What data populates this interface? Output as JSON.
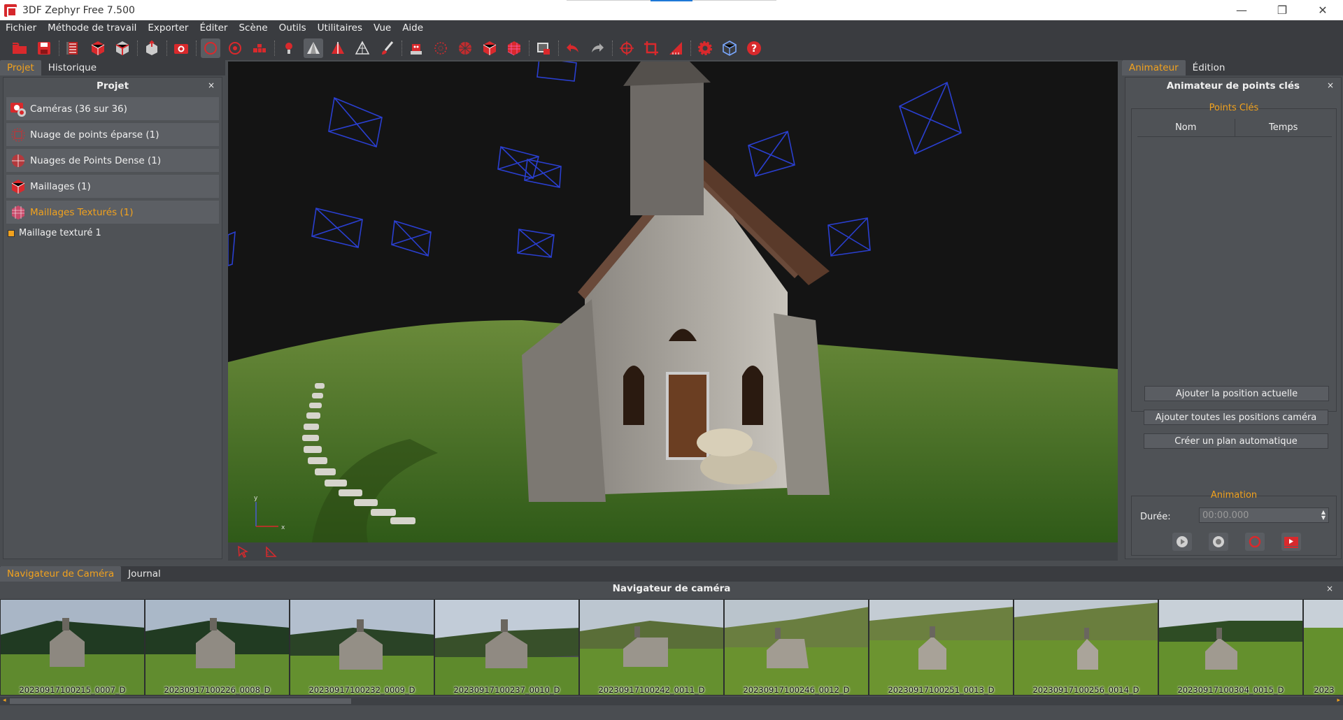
{
  "window": {
    "title": "3DF Zephyr Free 7.500",
    "buttons": [
      "—",
      "❐",
      "✕"
    ]
  },
  "menu": [
    "Fichier",
    "Méthode de travail",
    "Exporter",
    "Éditer",
    "Scène",
    "Outils",
    "Utilitaires",
    "Vue",
    "Aide"
  ],
  "left": {
    "tabs": [
      "Projet",
      "Historique"
    ],
    "title": "Projet",
    "close": "×",
    "items": [
      {
        "label": "Caméras (36 sur 36)"
      },
      {
        "label": "Nuage de points éparse (1)"
      },
      {
        "label": "Nuages de Points Dense (1)"
      },
      {
        "label": "Maillages (1)"
      },
      {
        "label": "Maillages Texturés (1)"
      }
    ],
    "subitem": "Maillage texturé 1"
  },
  "viewport": {
    "axis_x": "x",
    "axis_y": "y"
  },
  "right": {
    "tabs": [
      "Animateur",
      "Édition"
    ],
    "title": "Animateur de points clés",
    "close": "×",
    "keypoints_label": "Points Clés",
    "columns": [
      "Nom",
      "Temps"
    ],
    "buttons": [
      "Ajouter la position actuelle",
      "Ajouter toutes les positions caméra",
      "Créer un plan automatique"
    ],
    "animation_label": "Animation",
    "duration_label": "Durée:",
    "duration_value": "00:00.000"
  },
  "bottom": {
    "tabs": [
      "Navigateur de Caméra",
      "Journal"
    ],
    "title": "Navigateur de caméra",
    "close": "×",
    "thumbnails": [
      "20230917100215_0007_D",
      "20230917100226_0008_D",
      "20230917100232_0009_D",
      "20230917100237_0010_D",
      "20230917100242_0011_D",
      "20230917100246_0012_D",
      "20230917100251_0013_D",
      "20230917100256_0014_D",
      "20230917100304_0015_D",
      "2023"
    ]
  },
  "colors": {
    "accent": "#f2a21d",
    "panel": "#4a4d51",
    "toolbar": "#3a3c40",
    "camera_frame": "#2a3fd0"
  }
}
